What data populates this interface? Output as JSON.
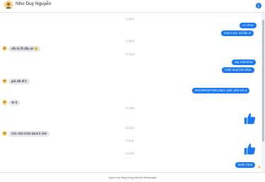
{
  "header": {
    "name": "Như Duy Nguyễn"
  },
  "timestamps": [
    "17:18:02",
    "17:18:11",
    "17:19:44",
    "17:19:55",
    "17:20:12",
    "17:20:22",
    "17:20:32"
  ],
  "messages": [
    {
      "text": "có chưa"
    },
    {
      "text": "mua 3 scc mà lâu vl"
    },
    {
      "text": "vẫn bị lỗi đấy ạk 😊"
    },
    {
      "text": "vậy refund lại"
    },
    {
      "text": "mình mua bên khác"
    },
    {
      "text": "giải sắt đi b"
    },
    {
      "text": "0041000187190 phạm quốc phú vcb ạ"
    },
    {
      "text": "ok b"
    },
    {
      "text": "chờ chút mình bank b nhé"
    },
    {
      "text": "bank chưa"
    }
  ],
  "footer": {
    "text": "Người này đang sống mặt trên Messenger"
  },
  "colors": {
    "accent": "#1877f2",
    "incoming": "#e4e6eb"
  }
}
